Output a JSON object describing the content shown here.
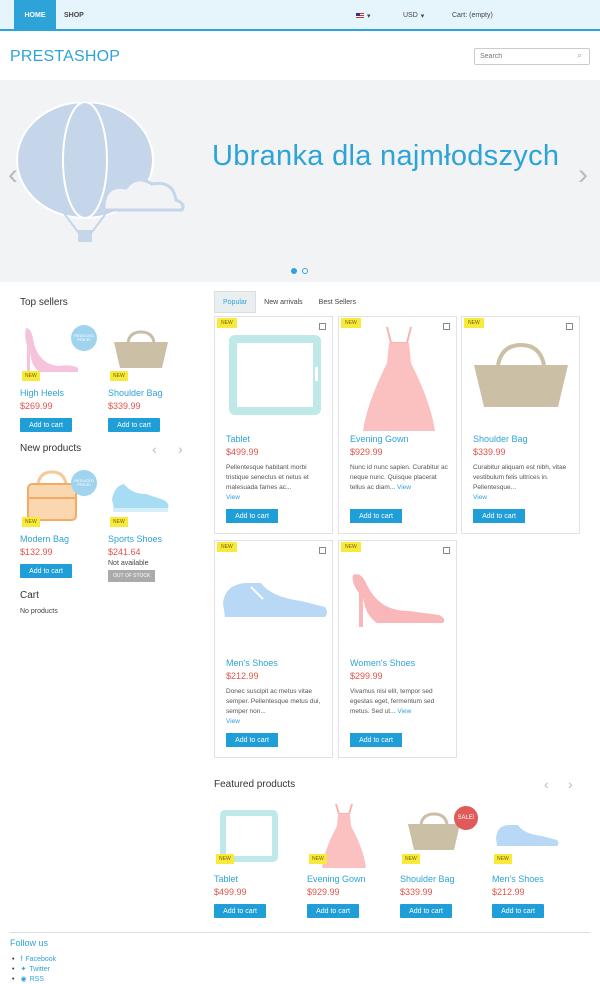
{
  "topbar": {
    "home": "HOME",
    "shop": "SHOP",
    "currency": "USD",
    "cart": "Cart: (empty)"
  },
  "header": {
    "logo": "PRESTASHOP",
    "search_placeholder": "Search"
  },
  "slider": {
    "title": "Ubranka dla najmłodszych"
  },
  "top_sellers": {
    "title": "Top sellers",
    "items": [
      {
        "name": "High Heels",
        "price": "$269.99",
        "badge": "NEW",
        "reduced": "REDUCED PRICE!",
        "button": "Add to cart"
      },
      {
        "name": "Shoulder Bag",
        "price": "$339.99",
        "badge": "NEW",
        "button": "Add to cart"
      }
    ]
  },
  "new_products": {
    "title": "New products",
    "items": [
      {
        "name": "Modern Bag",
        "price": "$132.99",
        "badge": "NEW",
        "reduced": "REDUCED PRICE!",
        "button": "Add to cart"
      },
      {
        "name": "Sports Shoes",
        "price": "$241.64",
        "badge": "NEW",
        "availability": "Not available",
        "stock": "OUT OF STOCK"
      }
    ]
  },
  "cart": {
    "title": "Cart",
    "empty": "No products"
  },
  "tabs": [
    "Popular",
    "New arrivals",
    "Best Sellers"
  ],
  "products": [
    {
      "name": "Tablet",
      "price": "$499.99",
      "badge": "NEW",
      "desc": "Pellentesque habitant morbi tristique senectus et netus et malesuada fames ac...",
      "view": "View",
      "button": "Add to cart"
    },
    {
      "name": "Evening Gown",
      "price": "$929.99",
      "badge": "NEW",
      "desc": "Nunc id nunc sapien. Curabitur ac neque nunc. Quisque placerat tellus ac diam...",
      "view": "View",
      "button": "Add to cart"
    },
    {
      "name": "Shoulder Bag",
      "price": "$339.99",
      "badge": "NEW",
      "desc": "Curabitur aliquam est nibh, vitae vestibulum felis ultrices in. Pellentesque...",
      "view": "View",
      "button": "Add to cart"
    },
    {
      "name": "Men's Shoes",
      "price": "$212.99",
      "badge": "NEW",
      "desc": "Donec suscipit ac metus vitae semper. Pellentesque metus dui, semper non...",
      "view": "View",
      "button": "Add to cart"
    },
    {
      "name": "Women's Shoes",
      "price": "$299.99",
      "badge": "NEW",
      "desc": "Vivamus nisi elit, tempor sed egestas eget, fermentum sed metus. Sed ut...",
      "view": "View",
      "button": "Add to cart"
    }
  ],
  "featured": {
    "title": "Featured products",
    "items": [
      {
        "name": "Tablet",
        "price": "$499.99",
        "badge": "NEW",
        "button": "Add to cart"
      },
      {
        "name": "Evening Gown",
        "price": "$929.99",
        "badge": "NEW",
        "button": "Add to cart"
      },
      {
        "name": "Shoulder Bag",
        "price": "$339.99",
        "badge": "NEW",
        "sale": "SALE!",
        "button": "Add to cart"
      },
      {
        "name": "Men's Shoes",
        "price": "$212.99",
        "badge": "NEW",
        "button": "Add to cart"
      }
    ]
  },
  "footer": {
    "follow": "Follow us",
    "links": [
      "Facebook",
      "Twitter",
      "RSS"
    ]
  }
}
